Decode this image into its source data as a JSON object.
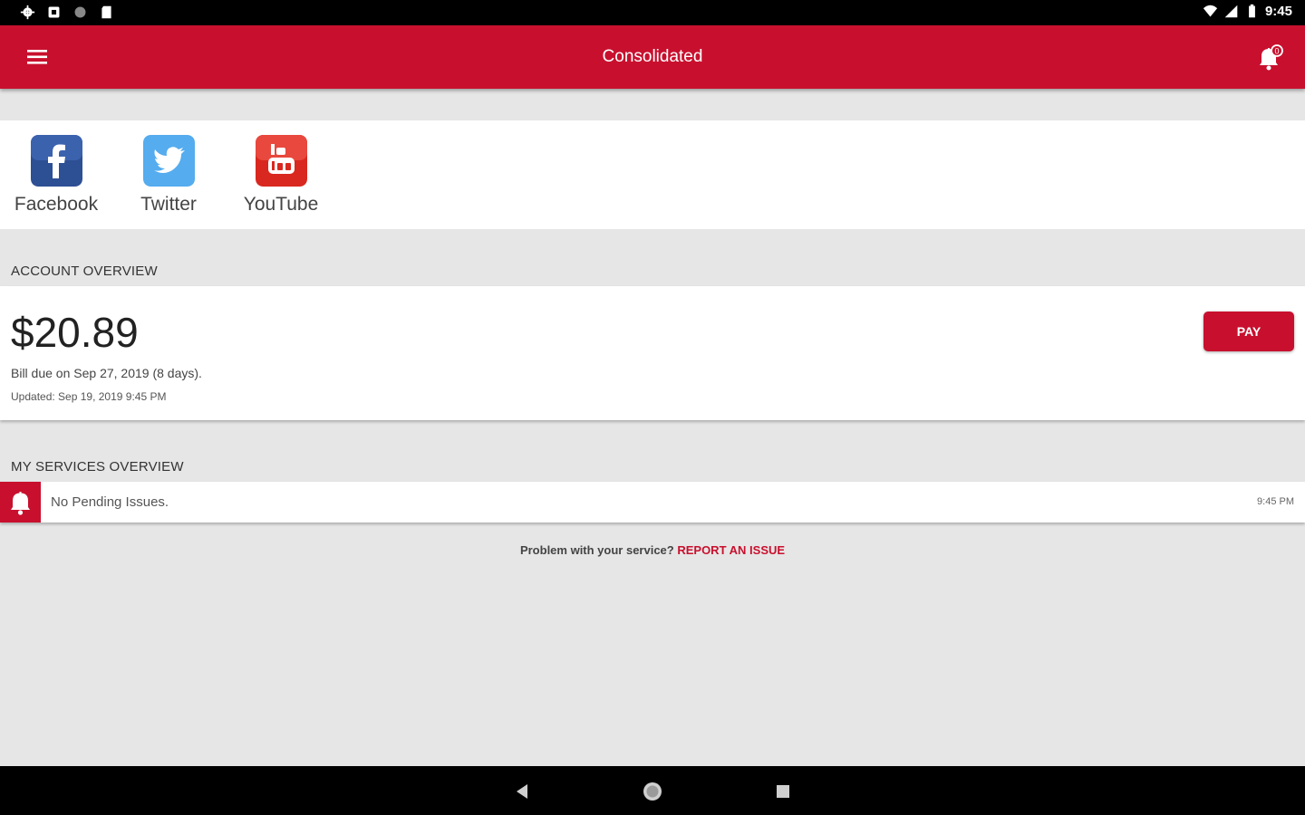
{
  "status_bar": {
    "time": "9:45",
    "left_icons": [
      "settings-icon",
      "app-icon",
      "circle-icon",
      "sd-card-icon"
    ],
    "right_icons": [
      "wifi-icon",
      "signal-icon",
      "battery-icon"
    ]
  },
  "app_bar": {
    "title": "Consolidated",
    "menu_icon": "hamburger-menu-icon",
    "notification_icon": "bell-icon"
  },
  "social": {
    "items": [
      {
        "label": "Facebook",
        "icon": "facebook-icon",
        "color": "#3b5998"
      },
      {
        "label": "Twitter",
        "icon": "twitter-icon",
        "color": "#55acee"
      },
      {
        "label": "YouTube",
        "icon": "youtube-icon",
        "color": "#e52d27"
      }
    ]
  },
  "account": {
    "section_title": "ACCOUNT OVERVIEW",
    "amount": "$20.89",
    "due_text": "Bill due on Sep 27, 2019 (8 days).",
    "updated_text": "Updated:  Sep 19, 2019 9:45 PM",
    "pay_label": "PAY"
  },
  "services": {
    "section_title": "MY SERVICES OVERVIEW",
    "alert_text": "No Pending Issues.",
    "alert_time": "9:45 PM",
    "alert_icon": "bell-icon"
  },
  "report": {
    "prompt": "Problem with your service? ",
    "link_label": "REPORT AN ISSUE"
  },
  "nav_bar": {
    "buttons": [
      "back-icon",
      "home-icon",
      "recents-icon"
    ]
  },
  "colors": {
    "brand_red": "#c8102e",
    "background": "#e6e6e6"
  }
}
